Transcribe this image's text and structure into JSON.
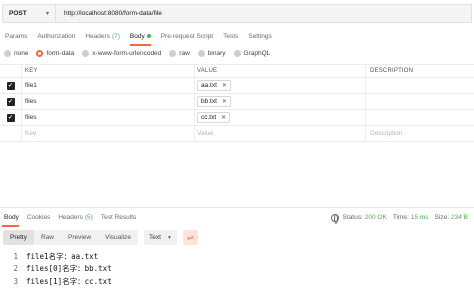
{
  "request": {
    "method": "POST",
    "url": "http://localhost:8080/form-data/file"
  },
  "request_tabs": [
    {
      "label": "Params"
    },
    {
      "label": "Authorization"
    },
    {
      "label": "Headers",
      "count": "(7)"
    },
    {
      "label": "Body"
    },
    {
      "label": "Pre-request Script"
    },
    {
      "label": "Tests"
    },
    {
      "label": "Settings"
    }
  ],
  "body_types": [
    "none",
    "form-data",
    "x-www-form-urlencoded",
    "raw",
    "binary",
    "GraphQL"
  ],
  "params_table": {
    "headers": [
      "KEY",
      "VALUE",
      "DESCRIPTION"
    ],
    "rows": [
      {
        "key": "file1",
        "value": "aa.txt"
      },
      {
        "key": "files",
        "value": "bb.txt"
      },
      {
        "key": "files",
        "value": "cc.txt"
      }
    ],
    "placeholder": {
      "key": "Key",
      "value": "Value",
      "description": "Description"
    }
  },
  "response_tabs": [
    {
      "label": "Body"
    },
    {
      "label": "Cookies"
    },
    {
      "label": "Headers",
      "count": "(5)"
    },
    {
      "label": "Test Results"
    }
  ],
  "status": {
    "status_label": "Status:",
    "status_value": "200 OK",
    "time_label": "Time:",
    "time_value": "15 ms",
    "size_label": "Size:",
    "size_value": "234 B"
  },
  "view_modes": [
    "Pretty",
    "Raw",
    "Preview",
    "Visualize"
  ],
  "format_select": "Text",
  "response_lines": [
    {
      "num": "1",
      "text": "file1名字：aa.txt"
    },
    {
      "num": "2",
      "text": "files[0]名字：bb.txt"
    },
    {
      "num": "3",
      "text": "files[1]名字：cc.txt"
    }
  ],
  "colors": {
    "accent": "#f26b3a",
    "success": "#4caf50"
  }
}
